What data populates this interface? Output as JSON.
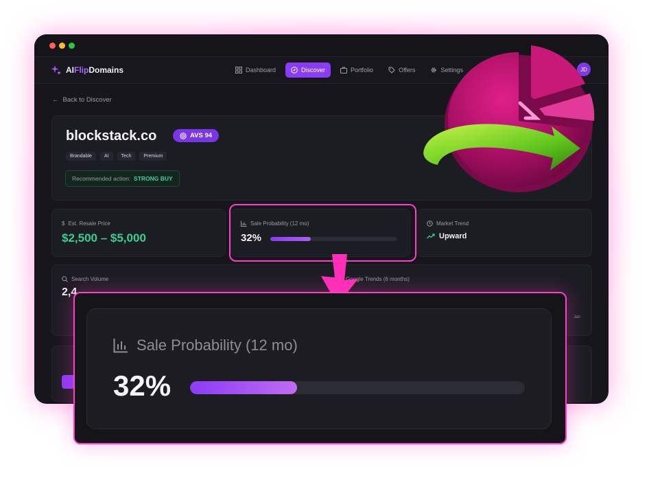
{
  "brand": {
    "name_prefix": "AI",
    "name_accent": "Flip",
    "name_suffix": "Domains"
  },
  "nav": {
    "items": [
      {
        "label": "Dashboard",
        "icon": "grid-icon",
        "active": false
      },
      {
        "label": "Discover",
        "icon": "compass-icon",
        "active": true
      },
      {
        "label": "Portfolio",
        "icon": "briefcase-icon",
        "active": false
      },
      {
        "label": "Offers",
        "icon": "tag-icon",
        "active": false
      },
      {
        "label": "Settings",
        "icon": "gear-icon",
        "active": false
      }
    ],
    "avatar_initials": "JD"
  },
  "back_link": "Back to Discover",
  "domain": {
    "name": "blockstack.co",
    "avs_badge": "AVS 94",
    "tags": [
      "Brandable",
      "AI",
      "Tech",
      "Premium"
    ],
    "recommendation_label": "Recommended action:",
    "recommendation_value": "STRONG BUY"
  },
  "metrics": {
    "resale": {
      "label": "Est. Resale Price",
      "value": "$2,500 – $5,000",
      "icon": "dollar-icon"
    },
    "probability": {
      "label": "Sale Probability (12 mo)",
      "value": "32%",
      "fraction": 0.32,
      "icon": "bar-chart-icon"
    },
    "trend": {
      "label": "Market Trend",
      "value": "Upward",
      "icon": "clock-icon"
    }
  },
  "search": {
    "volume_label": "Search Volume",
    "volume_value": "2,4",
    "trends_label": "Google Trends (6 months)",
    "trends_last_tick": "Jan"
  },
  "zoom": {
    "label": "Sale Probability (12 mo)",
    "value": "32%",
    "fraction": 0.32
  },
  "colors": {
    "accent": "#8b3cf7",
    "highlight": "#ff3fc8",
    "positive": "#37d08f"
  }
}
